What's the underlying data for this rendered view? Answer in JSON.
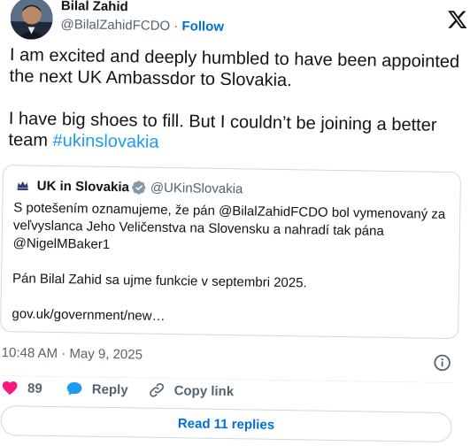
{
  "author": {
    "display_name": "Bilal Zahid",
    "handle": "@BilalZahidFCDO",
    "separator": "·",
    "follow_label": "Follow"
  },
  "tweet": {
    "text_line1": "I am excited and deeply humbled to have been appointed the next UK Ambassdor to Slovakia.",
    "text_line2": "I have big shoes to fill. But I couldn’t be joining a better team ",
    "hashtag": "#ukinslovakia"
  },
  "quote": {
    "display_name": "UK in Slovakia",
    "handle": "@UKinSlovakia",
    "line1": "S potešením oznamujeme, že pán @BilalZahidFCDO  bol vymenovaný za veľvyslanca Jeho Veličenstva na Slovensku a nahradí tak pána @NigelMBaker1",
    "line2": "Pán Bilal Zahid sa ujme funkcie v septembri 2025.",
    "link": "gov.uk/government/new…"
  },
  "meta": {
    "timestamp": "10:48 AM · May 9, 2025"
  },
  "actions": {
    "like_count": "89",
    "reply_label": "Reply",
    "copy_label": "Copy link"
  },
  "footer": {
    "read_replies_label": "Read 11 replies"
  },
  "colors": {
    "accent": "#1d9bf0",
    "link": "#006fd6",
    "like": "#f91880",
    "muted": "#536471",
    "border": "#cfd9de"
  },
  "icons": {
    "brand": "x-logo-icon",
    "verified": "verified-badge-icon",
    "info": "info-icon",
    "like": "heart-icon",
    "reply": "speech-bubble-icon",
    "copy": "link-icon"
  }
}
